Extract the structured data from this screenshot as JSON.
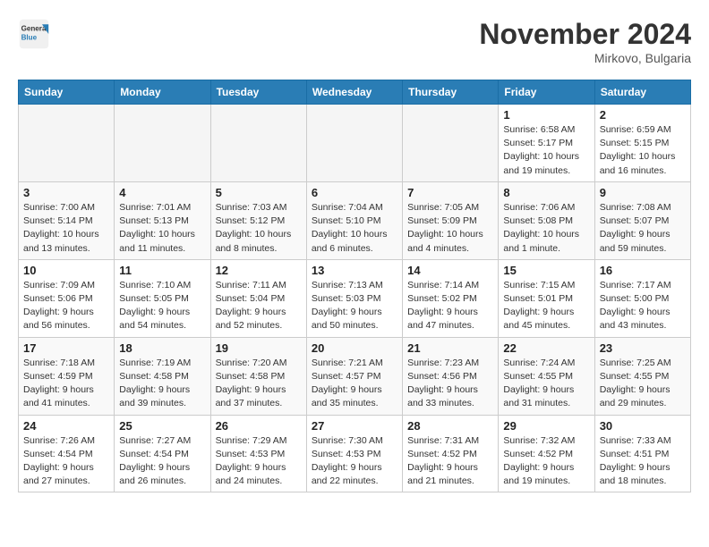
{
  "header": {
    "logo_general": "General",
    "logo_blue": "Blue",
    "month": "November 2024",
    "location": "Mirkovo, Bulgaria"
  },
  "weekdays": [
    "Sunday",
    "Monday",
    "Tuesday",
    "Wednesday",
    "Thursday",
    "Friday",
    "Saturday"
  ],
  "weeks": [
    [
      {
        "day": "",
        "info": ""
      },
      {
        "day": "",
        "info": ""
      },
      {
        "day": "",
        "info": ""
      },
      {
        "day": "",
        "info": ""
      },
      {
        "day": "",
        "info": ""
      },
      {
        "day": "1",
        "info": "Sunrise: 6:58 AM\nSunset: 5:17 PM\nDaylight: 10 hours\nand 19 minutes."
      },
      {
        "day": "2",
        "info": "Sunrise: 6:59 AM\nSunset: 5:15 PM\nDaylight: 10 hours\nand 16 minutes."
      }
    ],
    [
      {
        "day": "3",
        "info": "Sunrise: 7:00 AM\nSunset: 5:14 PM\nDaylight: 10 hours\nand 13 minutes."
      },
      {
        "day": "4",
        "info": "Sunrise: 7:01 AM\nSunset: 5:13 PM\nDaylight: 10 hours\nand 11 minutes."
      },
      {
        "day": "5",
        "info": "Sunrise: 7:03 AM\nSunset: 5:12 PM\nDaylight: 10 hours\nand 8 minutes."
      },
      {
        "day": "6",
        "info": "Sunrise: 7:04 AM\nSunset: 5:10 PM\nDaylight: 10 hours\nand 6 minutes."
      },
      {
        "day": "7",
        "info": "Sunrise: 7:05 AM\nSunset: 5:09 PM\nDaylight: 10 hours\nand 4 minutes."
      },
      {
        "day": "8",
        "info": "Sunrise: 7:06 AM\nSunset: 5:08 PM\nDaylight: 10 hours\nand 1 minute."
      },
      {
        "day": "9",
        "info": "Sunrise: 7:08 AM\nSunset: 5:07 PM\nDaylight: 9 hours\nand 59 minutes."
      }
    ],
    [
      {
        "day": "10",
        "info": "Sunrise: 7:09 AM\nSunset: 5:06 PM\nDaylight: 9 hours\nand 56 minutes."
      },
      {
        "day": "11",
        "info": "Sunrise: 7:10 AM\nSunset: 5:05 PM\nDaylight: 9 hours\nand 54 minutes."
      },
      {
        "day": "12",
        "info": "Sunrise: 7:11 AM\nSunset: 5:04 PM\nDaylight: 9 hours\nand 52 minutes."
      },
      {
        "day": "13",
        "info": "Sunrise: 7:13 AM\nSunset: 5:03 PM\nDaylight: 9 hours\nand 50 minutes."
      },
      {
        "day": "14",
        "info": "Sunrise: 7:14 AM\nSunset: 5:02 PM\nDaylight: 9 hours\nand 47 minutes."
      },
      {
        "day": "15",
        "info": "Sunrise: 7:15 AM\nSunset: 5:01 PM\nDaylight: 9 hours\nand 45 minutes."
      },
      {
        "day": "16",
        "info": "Sunrise: 7:17 AM\nSunset: 5:00 PM\nDaylight: 9 hours\nand 43 minutes."
      }
    ],
    [
      {
        "day": "17",
        "info": "Sunrise: 7:18 AM\nSunset: 4:59 PM\nDaylight: 9 hours\nand 41 minutes."
      },
      {
        "day": "18",
        "info": "Sunrise: 7:19 AM\nSunset: 4:58 PM\nDaylight: 9 hours\nand 39 minutes."
      },
      {
        "day": "19",
        "info": "Sunrise: 7:20 AM\nSunset: 4:58 PM\nDaylight: 9 hours\nand 37 minutes."
      },
      {
        "day": "20",
        "info": "Sunrise: 7:21 AM\nSunset: 4:57 PM\nDaylight: 9 hours\nand 35 minutes."
      },
      {
        "day": "21",
        "info": "Sunrise: 7:23 AM\nSunset: 4:56 PM\nDaylight: 9 hours\nand 33 minutes."
      },
      {
        "day": "22",
        "info": "Sunrise: 7:24 AM\nSunset: 4:55 PM\nDaylight: 9 hours\nand 31 minutes."
      },
      {
        "day": "23",
        "info": "Sunrise: 7:25 AM\nSunset: 4:55 PM\nDaylight: 9 hours\nand 29 minutes."
      }
    ],
    [
      {
        "day": "24",
        "info": "Sunrise: 7:26 AM\nSunset: 4:54 PM\nDaylight: 9 hours\nand 27 minutes."
      },
      {
        "day": "25",
        "info": "Sunrise: 7:27 AM\nSunset: 4:54 PM\nDaylight: 9 hours\nand 26 minutes."
      },
      {
        "day": "26",
        "info": "Sunrise: 7:29 AM\nSunset: 4:53 PM\nDaylight: 9 hours\nand 24 minutes."
      },
      {
        "day": "27",
        "info": "Sunrise: 7:30 AM\nSunset: 4:53 PM\nDaylight: 9 hours\nand 22 minutes."
      },
      {
        "day": "28",
        "info": "Sunrise: 7:31 AM\nSunset: 4:52 PM\nDaylight: 9 hours\nand 21 minutes."
      },
      {
        "day": "29",
        "info": "Sunrise: 7:32 AM\nSunset: 4:52 PM\nDaylight: 9 hours\nand 19 minutes."
      },
      {
        "day": "30",
        "info": "Sunrise: 7:33 AM\nSunset: 4:51 PM\nDaylight: 9 hours\nand 18 minutes."
      }
    ]
  ]
}
